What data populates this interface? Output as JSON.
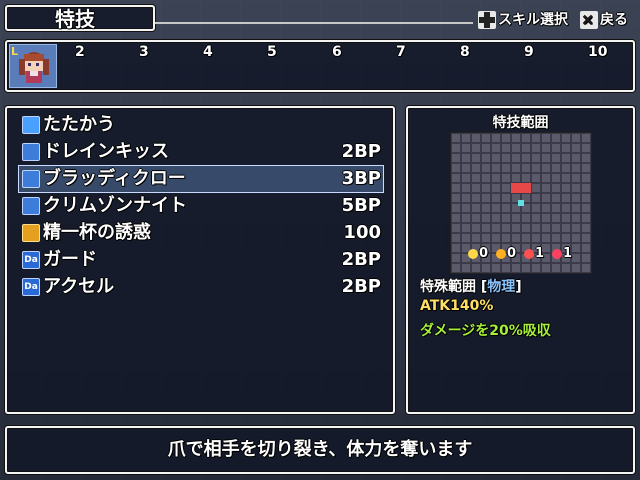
{
  "header": {
    "title": "特技",
    "hint_skill_select": "スキル選択",
    "hint_back": "戻る"
  },
  "party": {
    "portrait_badge": "L",
    "slots": [
      "2",
      "3",
      "4",
      "5",
      "6",
      "7",
      "8",
      "9",
      "10"
    ]
  },
  "skills": [
    {
      "name": "たたかう",
      "cost": "",
      "icon": "sword-icon",
      "color": "#4aa0ff"
    },
    {
      "name": "ドレインキッス",
      "cost": "2BP",
      "icon": "skill-icon",
      "color": "#3b7dd8"
    },
    {
      "name": "ブラッディクロー",
      "cost": "3BP",
      "icon": "skill-icon",
      "color": "#3b7dd8",
      "selected": true
    },
    {
      "name": "クリムゾンナイト",
      "cost": "5BP",
      "icon": "skill-icon",
      "color": "#3b7dd8"
    },
    {
      "name": "精一杯の誘惑",
      "cost": "100",
      "icon": "special-icon",
      "color": "#e6a020"
    },
    {
      "name": "ガード",
      "cost": "2BP",
      "icon": "da-icon",
      "color": "#2a6ad6"
    },
    {
      "name": "アクセル",
      "cost": "2BP",
      "icon": "da-icon",
      "color": "#2a6ad6"
    }
  ],
  "range_panel": {
    "title": "特技範囲",
    "markers": [
      {
        "value": "0",
        "color": "#ffd84a"
      },
      {
        "value": "0",
        "color": "#ffb020"
      },
      {
        "value": "1",
        "color": "#ff5050"
      },
      {
        "value": "1",
        "color": "#ff4060"
      }
    ],
    "range_label": "特殊範囲",
    "range_type_tag": "物理",
    "atk": "ATK140%",
    "effect": "ダメージを20%吸収"
  },
  "description": "爪で相手を切り裂き、体力を奪います"
}
